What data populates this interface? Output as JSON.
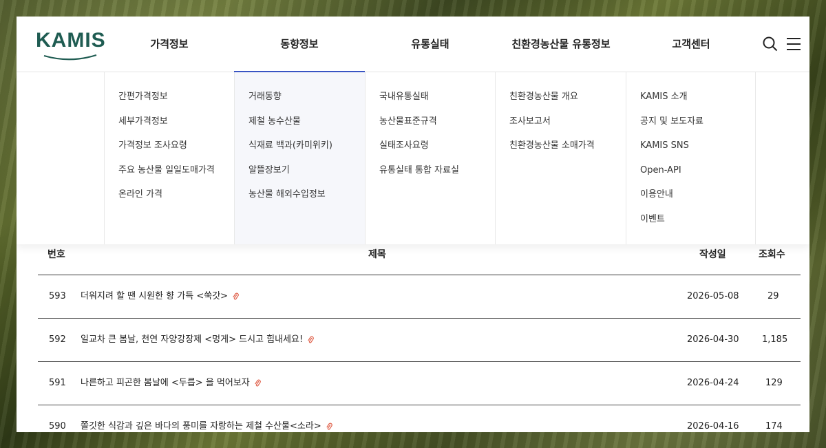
{
  "logo": {
    "text": "KAMIS"
  },
  "nav": {
    "items": [
      {
        "label": "가격정보",
        "active": false
      },
      {
        "label": "동향정보",
        "active": true
      },
      {
        "label": "유통실태",
        "active": false
      },
      {
        "label": "친환경농산물 유통정보",
        "active": false
      },
      {
        "label": "고객센터",
        "active": false
      }
    ]
  },
  "icons": {
    "search": "search-icon",
    "menu": "hamburger-menu-icon",
    "attachment": "paperclip-icon"
  },
  "mega": {
    "columns": [
      {
        "links": [
          "간편가격정보",
          "세부가격정보",
          "가격정보 조사요령",
          "주요 농산물 일일도매가격",
          "온라인 가격"
        ]
      },
      {
        "links": [
          "거래동향",
          "제철 농수산물",
          "식재료 백과(카미위키)",
          "알뜰장보기",
          "농산물 해외수입정보"
        ]
      },
      {
        "links": [
          "국내유통실태",
          "농산물표준규격",
          "실태조사요령",
          "유통실태 통합 자료실"
        ]
      },
      {
        "links": [
          "친환경농산물 개요",
          "조사보고서",
          "친환경농산물 소매가격"
        ]
      },
      {
        "links": [
          "KAMIS 소개",
          "공지 및 보도자료",
          "KAMIS SNS",
          "Open-API",
          "이용안내",
          "이벤트"
        ]
      }
    ]
  },
  "table": {
    "headers": {
      "no": "번호",
      "title": "제목",
      "date": "작성일",
      "views": "조회수"
    },
    "rows": [
      {
        "no": "593",
        "title": "더워지려 할 땐 시원한 향 가득 <쑥갓>",
        "date": "2026-05-08",
        "views": "29"
      },
      {
        "no": "592",
        "title": "일교차 큰 봄날, 천연 자양강장제 <멍게> 드시고 힘내세요!",
        "date": "2026-04-30",
        "views": "1,185"
      },
      {
        "no": "591",
        "title": "나른하고 피곤한 봄날에 <두릅> 을 먹어보자",
        "date": "2026-04-24",
        "views": "129"
      },
      {
        "no": "590",
        "title": "쫄깃한 식감과 깊은 바다의 풍미를 자랑하는 제철 수산물<소라>",
        "date": "2026-04-16",
        "views": "174"
      }
    ]
  },
  "colors": {
    "accent": "#3a55c4",
    "logo": "#1f5c52",
    "clip": "#e0604a"
  }
}
